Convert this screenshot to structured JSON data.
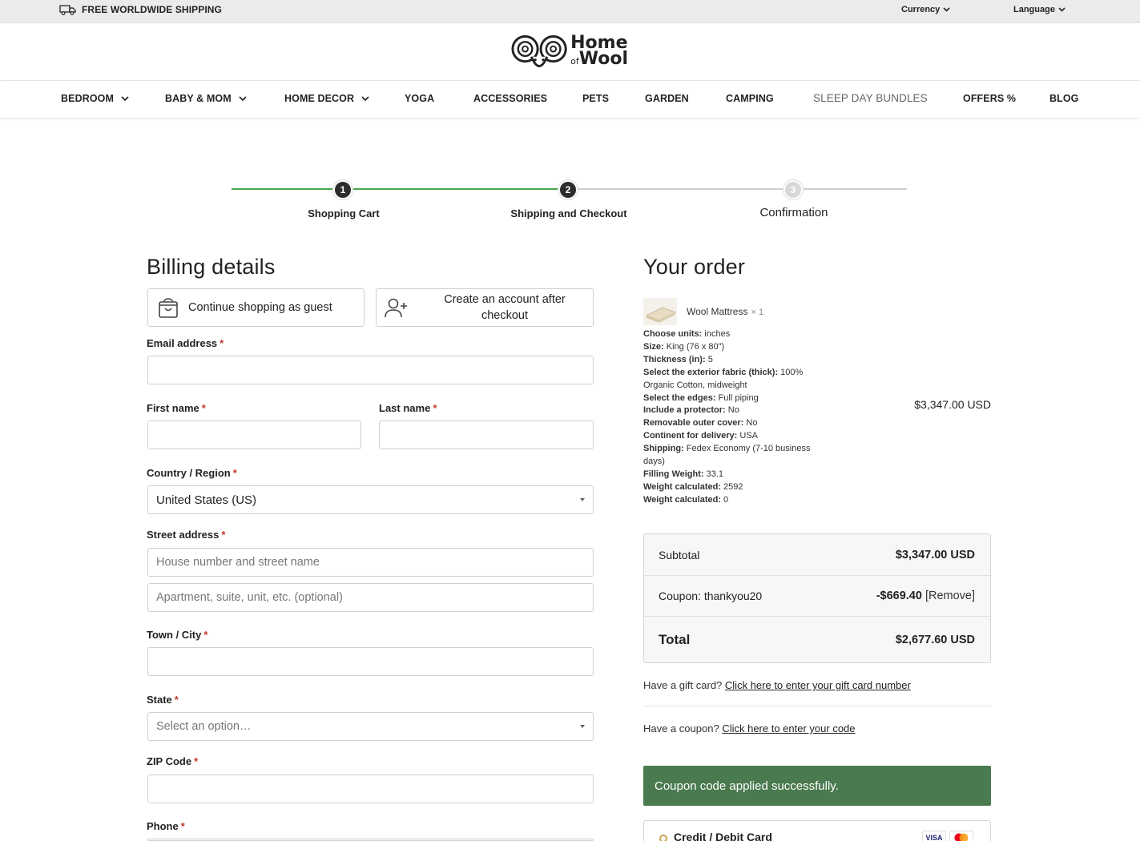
{
  "topbar": {
    "shipping": "FREE WORLDWIDE SHIPPING",
    "currency": "Currency",
    "language": "Language"
  },
  "logo": {
    "line1": "Home",
    "of": "of",
    "line2": "Wool"
  },
  "nav": [
    {
      "label": "BEDROOM",
      "dropdown": true
    },
    {
      "label": "BABY & MOM",
      "dropdown": true
    },
    {
      "label": "HOME DECOR",
      "dropdown": true
    },
    {
      "label": "YOGA",
      "dropdown": false
    },
    {
      "label": "ACCESSORIES",
      "dropdown": false
    },
    {
      "label": "PETS",
      "dropdown": false
    },
    {
      "label": "GARDEN",
      "dropdown": false
    },
    {
      "label": "CAMPING",
      "dropdown": false
    },
    {
      "label": "SLEEP DAY BUNDLES",
      "dropdown": false
    },
    {
      "label": "OFFERS %",
      "dropdown": false
    },
    {
      "label": "BLOG",
      "dropdown": false
    }
  ],
  "steps": [
    {
      "num": "1",
      "label": "Shopping Cart",
      "done": true
    },
    {
      "num": "2",
      "label": "Shipping and Checkout",
      "done": true
    },
    {
      "num": "3",
      "label": "Confirmation",
      "done": false
    }
  ],
  "billing": {
    "title": "Billing details",
    "guest": "Continue shopping as guest",
    "account": "Create an account after checkout",
    "email_label": "Email address",
    "first_label": "First name",
    "last_label": "Last name",
    "country_label": "Country / Region",
    "country_value": "United States (US)",
    "street_label": "Street address",
    "street_ph": "House number and street name",
    "apt_ph": "Apartment, suite, unit, etc. (optional)",
    "city_label": "Town / City",
    "state_label": "State",
    "state_value": "Select an option…",
    "zip_label": "ZIP Code",
    "phone_label": "Phone",
    "required": "*"
  },
  "order": {
    "title": "Your order",
    "product": "Wool Mattress",
    "qty": "× 1",
    "price": "$3,347.00 USD",
    "meta": [
      {
        "k": "Choose units:",
        "v": "inches"
      },
      {
        "k": "Size:",
        "v": "King (76 x 80\")"
      },
      {
        "k": "Thickness (in):",
        "v": "5"
      },
      {
        "k": "Select the exterior fabric (thick):",
        "v": "100% Organic Cotton, midweight"
      },
      {
        "k": "Select the edges:",
        "v": "Full piping"
      },
      {
        "k": "Include a protector:",
        "v": "No"
      },
      {
        "k": "Removable outer cover:",
        "v": "No"
      },
      {
        "k": "Continent for delivery:",
        "v": "USA"
      },
      {
        "k": "Shipping:",
        "v": "Fedex Economy (7-10 business days)"
      },
      {
        "k": "Filling Weight:",
        "v": "33.1"
      },
      {
        "k": "Weight calculated:",
        "v": "2592"
      },
      {
        "k": "Weight calculated:",
        "v": "0"
      }
    ],
    "subtotal_label": "Subtotal",
    "subtotal": "$3,347.00 USD",
    "coupon_label": "Coupon: thankyou20",
    "coupon_value": "-$669.40",
    "remove": "[Remove]",
    "total_label": "Total",
    "total": "$2,677.60 USD",
    "gift_q": "Have a gift card?",
    "gift_link": "Click here to enter your gift card number",
    "coupon_q": "Have a coupon?",
    "coupon_link": "Click here to enter your code",
    "alert": "Coupon code applied successfully.",
    "payment": "Credit / Debit Card",
    "visa": "VISA"
  },
  "colors": {
    "green": "#4aa84a",
    "alert": "#4a7a4f",
    "required": "#c0392b"
  }
}
